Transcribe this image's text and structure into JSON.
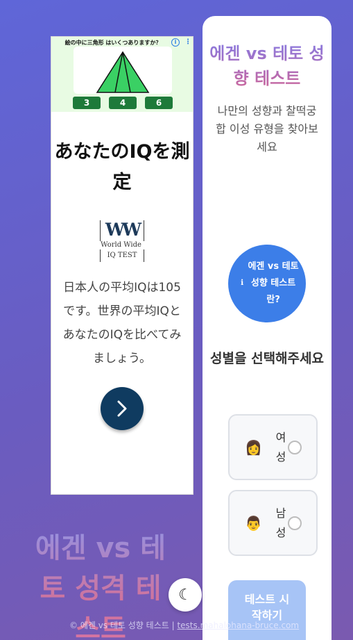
{
  "ad": {
    "question": "絵の中に三角形 はいくつありますか？",
    "answers": [
      "3",
      "4",
      "6"
    ],
    "headline": "あなたのIQを測定",
    "logo_main": "WW",
    "logo_sub": "World Wide",
    "logo_iq": "IQ TEST",
    "body": "日本人の平均IQは105です。世界の平均IQとあなたのIQを比べてみましょう。"
  },
  "card": {
    "title": "에겐 vs 테토 성향 테스트",
    "subtitle": "나만의 성향과 찰떡궁합 이성 유형을 찾아보세요",
    "info_icon": "ℹ",
    "info_button": "에겐 vs 테토 성향 테스트란?",
    "gender_title": "성별을 선택해주세요",
    "options": [
      {
        "emoji": "👩",
        "label": "여성"
      },
      {
        "emoji": "👨",
        "label": "남성"
      }
    ],
    "start_button": "테스트 시작하기"
  },
  "background_title": "에겐 vs 테토 성격 테스트",
  "theme_toggle_icon": "moon-icon",
  "footer": {
    "copyright": "© 에겐 vs 테토 성향 테스트 | ",
    "link": "tests.mahalohana-bruce.com"
  },
  "colors": {
    "accent_blue": "#3c7ee8",
    "start_button": "#a7c4f6",
    "ad_button": "#0f3b60"
  }
}
